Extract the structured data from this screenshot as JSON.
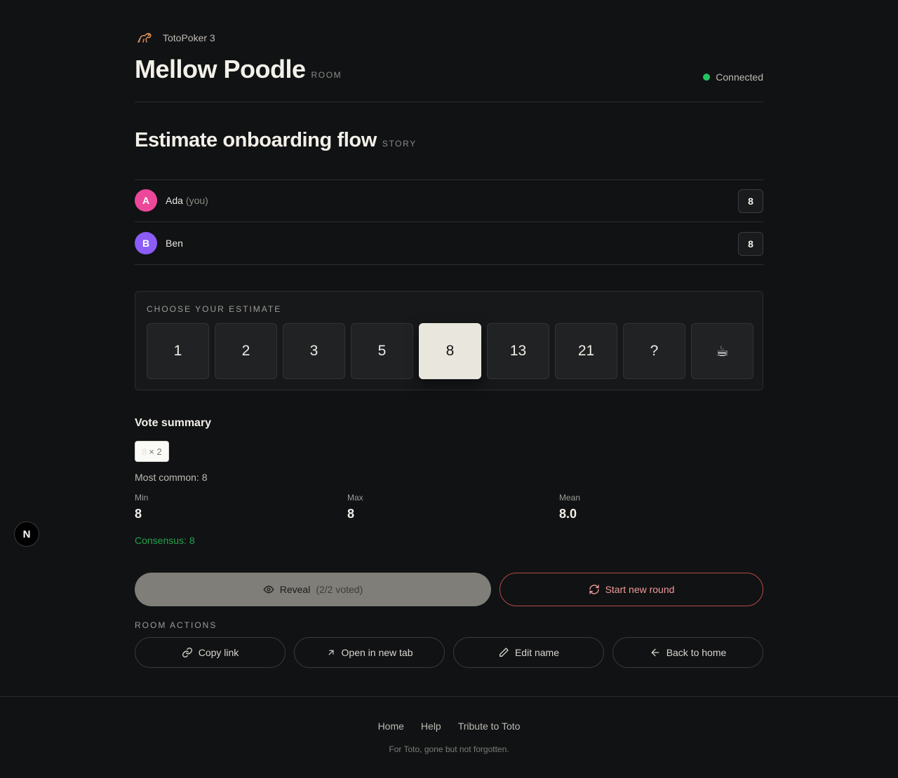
{
  "brand": {
    "name": "TotoPoker 3",
    "logo_icon": "dog-icon",
    "logo_color": "#d9905a"
  },
  "room": {
    "name": "Mellow Poodle",
    "tag": "ROOM"
  },
  "connection": {
    "status": "Connected",
    "color": "#22c55e"
  },
  "story": {
    "title": "Estimate onboarding flow",
    "tag": "STORY"
  },
  "players": [
    {
      "initial": "A",
      "name": "Ada",
      "suffix": "(you)",
      "vote": "8",
      "color": "#ec4899"
    },
    {
      "initial": "B",
      "name": "Ben",
      "suffix": "",
      "vote": "8",
      "color": "#8b5cf6"
    }
  ],
  "estimate": {
    "label": "CHOOSE YOUR ESTIMATE",
    "cards": [
      "1",
      "2",
      "3",
      "5",
      "8",
      "13",
      "21",
      "?",
      "☕"
    ],
    "selected": "8"
  },
  "summary": {
    "title": "Vote summary",
    "chip_value": "8",
    "chip_count": "× 2",
    "most_common": "Most common: 8",
    "min_label": "Min",
    "min_value": "8",
    "max_label": "Max",
    "max_value": "8",
    "mean_label": "Mean",
    "mean_value": "8.0",
    "consensus": "Consensus: 8"
  },
  "buttons": {
    "reveal": "Reveal",
    "reveal_count": "(2/2 voted)",
    "new_round": "Start new round"
  },
  "room_actions": {
    "label": "ROOM ACTIONS",
    "copy_link": "Copy link",
    "open_tab": "Open in new tab",
    "edit_name": "Edit name",
    "back_home": "Back to home"
  },
  "footer": {
    "links": [
      "Home",
      "Help",
      "Tribute to Toto"
    ],
    "note": "For Toto, gone but not forgotten."
  },
  "dev_badge": "N"
}
